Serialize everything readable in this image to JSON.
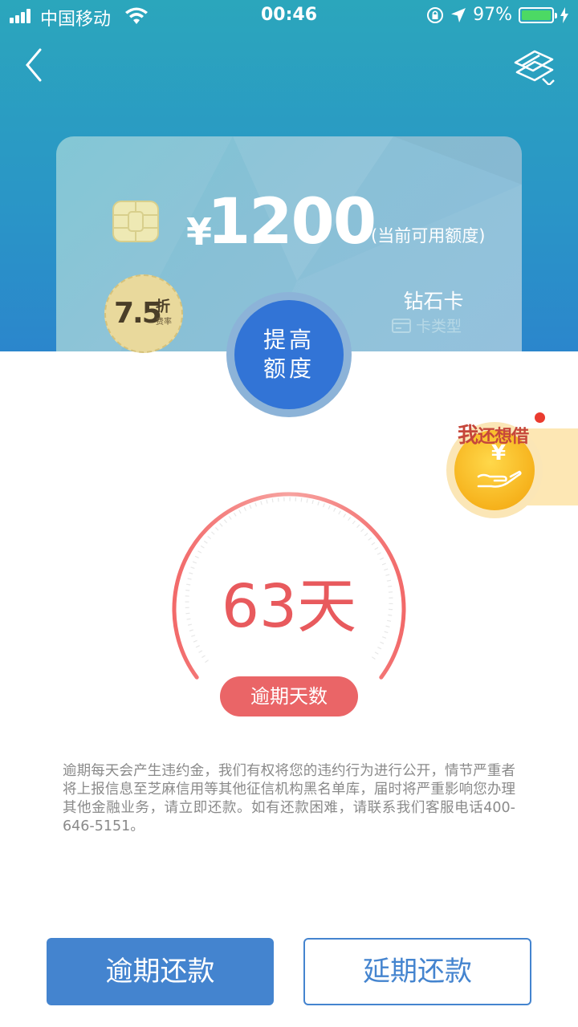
{
  "status_bar": {
    "carrier": "中国移动",
    "time": "00:46",
    "battery_percent": "97%",
    "battery_level": 0.97,
    "icons": [
      "signal-icon",
      "wifi-icon",
      "orientation-lock-icon",
      "location-arrow-icon",
      "battery-icon",
      "charging-icon"
    ]
  },
  "nav": {
    "back_icon": "chevron-left-icon",
    "cards_icon": "credit-cards-icon"
  },
  "card": {
    "currency_symbol": "¥",
    "amount": "1200",
    "amount_caption": "(当前可用额度)",
    "card_type": "钻石卡",
    "card_type_label": "卡类型",
    "chip_icon": "card-chip-icon",
    "card_type_icon": "card-icon"
  },
  "discount": {
    "value": "7.5",
    "unit": "折",
    "sub": "费率"
  },
  "raise_limit": {
    "line1": "提高",
    "line2": "额度"
  },
  "promo": {
    "prefix": "我",
    "rest": "还想借",
    "yen": "¥",
    "icon": "hand-coin-icon"
  },
  "overdue": {
    "days": "63天",
    "label": "逾期天数"
  },
  "notice": "逾期每天会产生违约金，我们有权将您的违约行为进行公开，情节严重者将上报信息至芝麻信用等其他征信机构黑名单库，届时将严重影响您办理其他金融业务，请立即还款。如有还款困难，请联系我们客服电话400-646-5151。",
  "buttons": {
    "repay_overdue": "逾期还款",
    "extend_repay": "延期还款"
  },
  "colors": {
    "header": "#2a9ac4",
    "primary": "#4484cf",
    "overdue_red": "#e85a5d",
    "raise_button": "#3274d6"
  }
}
